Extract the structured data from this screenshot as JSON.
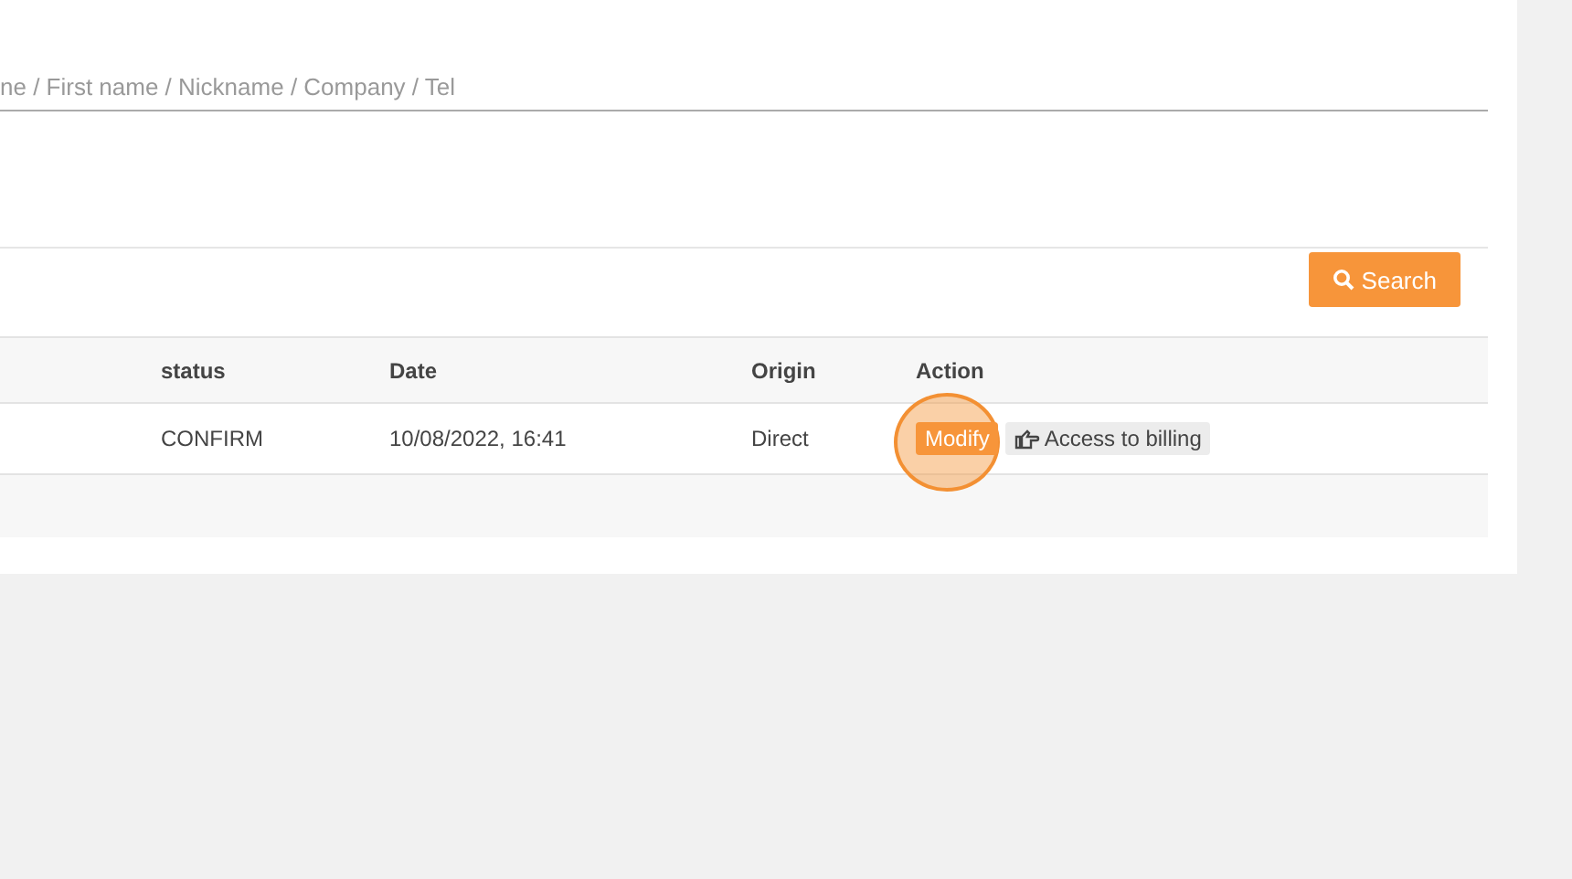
{
  "search_field": {
    "placeholder": "ne / First name / Nickname / Company / Tel"
  },
  "search_button": {
    "label": "Search"
  },
  "table": {
    "columns": [
      "status",
      "Date",
      "Origin",
      "Action"
    ],
    "rows": [
      {
        "status": "CONFIRM",
        "date": "10/08/2022, 16:41",
        "origin": "Direct",
        "actions": [
          {
            "kind": "modify",
            "label": "Modify"
          },
          {
            "kind": "billing",
            "label": "Access to billing"
          }
        ]
      }
    ]
  }
}
